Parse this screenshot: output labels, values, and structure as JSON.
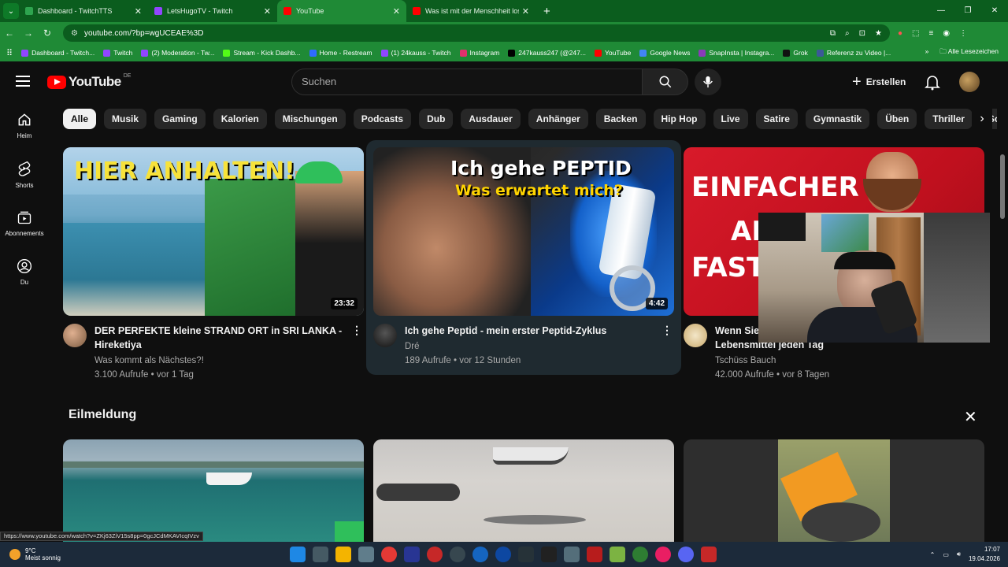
{
  "browser": {
    "tabs": [
      {
        "label": "Dashboard - TwitchTTS",
        "fav_color": "#2ea44f"
      },
      {
        "label": "LetsHugoTV - Twitch",
        "fav_color": "#9146ff"
      },
      {
        "label": "YouTube",
        "fav_color": "#ff0000"
      },
      {
        "label": "Was ist mit der Menschheit los?",
        "fav_color": "#ff0000"
      }
    ],
    "new_tab": "+",
    "url": "youtube.com/?bp=wgUCEAE%3D",
    "bookmarks": [
      {
        "label": "Dashboard - Twitch...",
        "color": "#9146ff"
      },
      {
        "label": "Twitch",
        "color": "#9146ff"
      },
      {
        "label": "(2) Moderation - Tw...",
        "color": "#9146ff"
      },
      {
        "label": "Stream - Kick Dashb...",
        "color": "#53fc18"
      },
      {
        "label": "Home - Restream",
        "color": "#2f6bff"
      },
      {
        "label": "(1) 24kauss - Twitch",
        "color": "#9146ff"
      },
      {
        "label": "Instagram",
        "color": "#e1306c"
      },
      {
        "label": "247kauss247 (@247...",
        "color": "#000000"
      },
      {
        "label": "YouTube",
        "color": "#ff0000"
      },
      {
        "label": "Google News",
        "color": "#4285f4"
      },
      {
        "label": "SnapInsta | Instagra...",
        "color": "#8a3ab9"
      },
      {
        "label": "Grok",
        "color": "#111111"
      },
      {
        "label": "Referenz zu Video |...",
        "color": "#3b5998"
      }
    ],
    "bookmarks_more": "»",
    "all_bookmarks": "Alle Lesezeichen"
  },
  "header": {
    "logo_word": "YouTube",
    "country": "DE",
    "search_placeholder": "Suchen",
    "create_label": "Erstellen"
  },
  "sidebar": {
    "items": [
      {
        "label": "Heim",
        "icon": "home-icon"
      },
      {
        "label": "Shorts",
        "icon": "shorts-icon"
      },
      {
        "label": "Abonnements",
        "icon": "subscriptions-icon"
      },
      {
        "label": "Du",
        "icon": "you-icon"
      }
    ]
  },
  "chips": [
    "Alle",
    "Musik",
    "Gaming",
    "Kalorien",
    "Mischungen",
    "Podcasts",
    "Dub",
    "Ausdauer",
    "Anhänger",
    "Backen",
    "Hip Hop",
    "Live",
    "Satire",
    "Gymnastik",
    "Üben",
    "Thriller",
    "Soulmus"
  ],
  "videos": [
    {
      "title": "DER PERFEKTE kleine STRAND ORT in SRI LANKA - Hireketiya",
      "channel": "Was kommt als Nächstes?!",
      "stats": "3.100 Aufrufe • vor 1 Tag",
      "duration": "23:32",
      "thumb_text": "HIER ANHALTEN!"
    },
    {
      "title": "Ich gehe Peptid - mein erster Peptid-Zyklus",
      "channel": "Dré",
      "stats": "189 Aufrufe • vor 12 Stunden",
      "duration": "4:42",
      "thumb_text_1": "Ich gehe PEPTID",
      "thumb_text_2": "Was erwartet mich?"
    },
    {
      "title_line1": "Wenn Sie",
      "title_line2": "Lebensmittel jeden Tag",
      "channel": "Tschüss Bauch",
      "stats": "42.000 Aufrufe • vor 8 Tagen",
      "thumb_text_1": "EINFACHER",
      "thumb_text_2": "AL",
      "thumb_text_3": "FAST"
    }
  ],
  "breaking": {
    "title": "Eilmeldung"
  },
  "status_url": "https://www.youtube.com/watch?v=ZKj63ZiV15s8pp=0gcJCdMKAVIcqIVzv",
  "taskbar": {
    "temp": "9°C",
    "weather": "Meist sonnig",
    "time": "17:07",
    "date": "19.04.2026"
  }
}
